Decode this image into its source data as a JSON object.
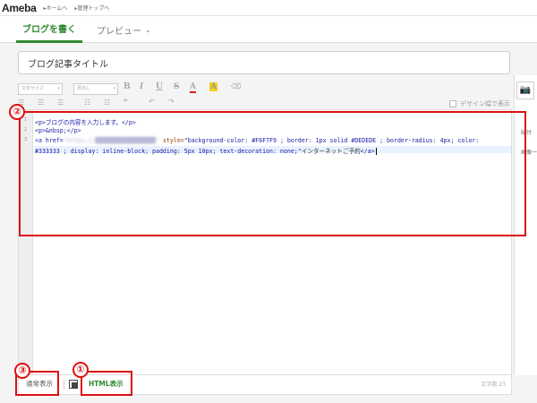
{
  "header": {
    "logo": "Ameba",
    "links": [
      "▸ホームへ",
      "▸管理トップへ"
    ]
  },
  "tabs": {
    "write": "ブログを書く",
    "preview": "プレビュー"
  },
  "title_input": {
    "value": "ブログ記事タイトル"
  },
  "toolbar": {
    "font_size": "文字サイズ",
    "font_style": "見出し",
    "bold": "B",
    "italic": "I",
    "underline": "U",
    "strike": "S",
    "text_color": "A",
    "bg_color": "A",
    "design_label": "デザイン幅で表示",
    "help": "?"
  },
  "editor": {
    "line_numbers": [
      "1",
      "2",
      "3"
    ],
    "line1": "<p>ブログの内容を入力します。</p>",
    "line2": "<p>&nbsp;</p>",
    "line3_tag": "<a href=",
    "line3_url": "\"https://█████████████████\"",
    "line3_style_attr": "style=",
    "line3_style_val": "\"background-color: #F6F7F9 ; border: 1px solid #DEDEDE ; border-radius: 4px; color:",
    "line4_style_val": "#333333 ; display: inline-block; padding: 5px 10px; text-decoration: none;\"",
    "line4_text": "インターネットご予約",
    "line4_close": "</a>"
  },
  "side_panel": {
    "labels": [
      "貼付",
      "画像一"
    ]
  },
  "bottom": {
    "normal_mode": "通常表示",
    "html_mode": "HTML表示",
    "char_count": "文字数 23"
  },
  "annotations": [
    "②",
    "③",
    "①"
  ],
  "colors": {
    "accent": "#2f8a2f",
    "annotation": "#dd1111"
  }
}
